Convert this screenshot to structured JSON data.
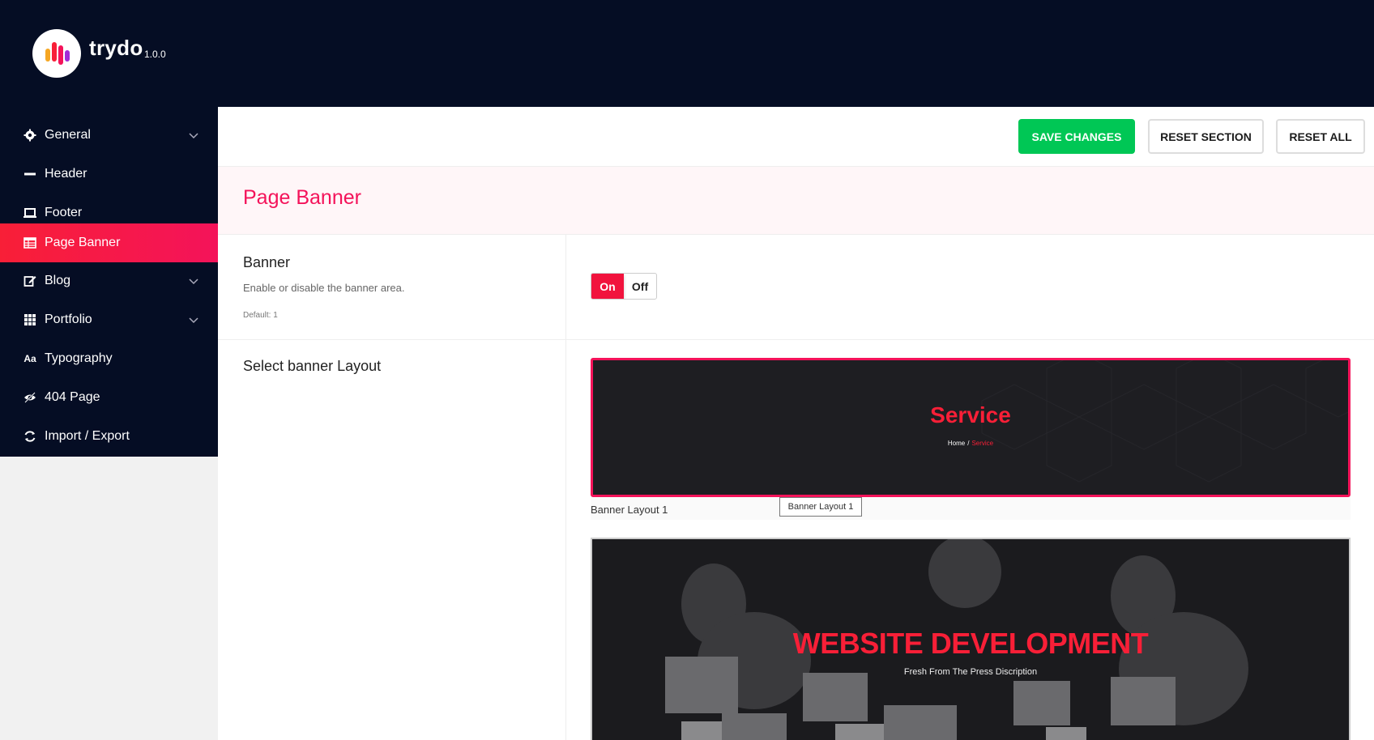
{
  "brand": {
    "name": "trydo",
    "version": "1.0.0"
  },
  "sidebar": {
    "items": [
      {
        "label": "General",
        "icon": "gear-icon",
        "has_submenu": true
      },
      {
        "label": "Header",
        "icon": "minus-icon",
        "has_submenu": false
      },
      {
        "label": "Footer",
        "icon": "laptop-icon",
        "has_submenu": false
      },
      {
        "label": "Page Banner",
        "icon": "table-icon",
        "has_submenu": false,
        "active": true
      },
      {
        "label": "Blog",
        "icon": "edit-icon",
        "has_submenu": true
      },
      {
        "label": "Portfolio",
        "icon": "grid-icon",
        "has_submenu": true
      },
      {
        "label": "Typography",
        "icon": "font-icon",
        "has_submenu": false
      },
      {
        "label": "404 Page",
        "icon": "eye-slash-icon",
        "has_submenu": false
      },
      {
        "label": "Import / Export",
        "icon": "refresh-icon",
        "has_submenu": false
      }
    ]
  },
  "toolbar": {
    "save_label": "SAVE CHANGES",
    "reset_section_label": "RESET SECTION",
    "reset_all_label": "RESET ALL"
  },
  "section": {
    "title": "Page Banner"
  },
  "banner_field": {
    "title": "Banner",
    "description": "Enable or disable the banner area.",
    "default_text": "Default: 1",
    "on_label": "On",
    "off_label": "Off",
    "value": "On"
  },
  "layout_field": {
    "title": "Select banner Layout",
    "layout1": {
      "preview_title": "Service",
      "crumb_home": "Home",
      "crumb_sep": "/",
      "crumb_current": "Service",
      "label": "Banner Layout 1",
      "tooltip": "Banner Layout 1",
      "selected": true
    },
    "layout2": {
      "preview_title": "WEBSITE DEVELOPMENT",
      "preview_subtitle": "Fresh From The Press Discription"
    }
  },
  "colors": {
    "sidebar_bg": "#050d24",
    "accent": "#f4135a",
    "save_green": "#00c755"
  }
}
